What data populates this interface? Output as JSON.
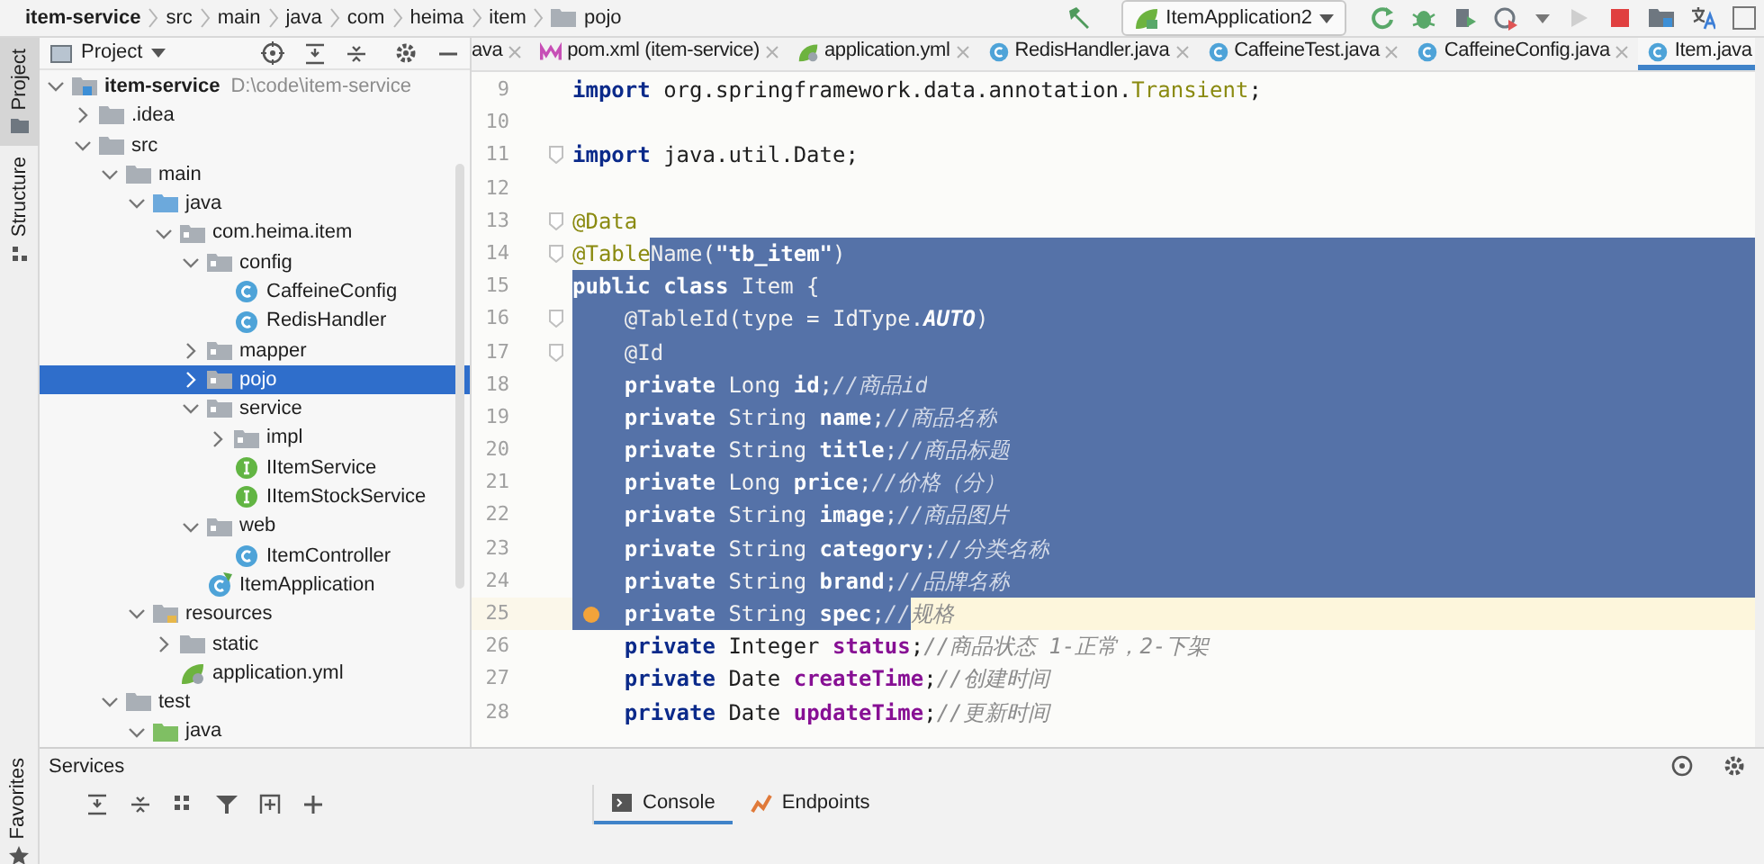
{
  "breadcrumbs": [
    {
      "label": "item-service",
      "kind": "module"
    },
    {
      "label": "src",
      "kind": "plain"
    },
    {
      "label": "main",
      "kind": "plain"
    },
    {
      "label": "java",
      "kind": "plain"
    },
    {
      "label": "com",
      "kind": "plain"
    },
    {
      "label": "heima",
      "kind": "plain"
    },
    {
      "label": "item",
      "kind": "plain"
    },
    {
      "label": "pojo",
      "kind": "package"
    }
  ],
  "run_config": {
    "label": "ItemApplication2"
  },
  "side_tabs": [
    {
      "label": "Project",
      "selected": true
    },
    {
      "label": "Structure",
      "selected": false
    }
  ],
  "side_tabs_bottom": [
    {
      "label": "Favorites",
      "selected": false
    }
  ],
  "project_panel": {
    "title": "Project",
    "tree": [
      {
        "name": "item-service",
        "kind": "module",
        "detail": "D:\\code\\item-service",
        "expanded": true,
        "selected": false,
        "children": [
          {
            "name": ".idea",
            "kind": "folder",
            "expanded": false,
            "selected": false
          },
          {
            "name": "src",
            "kind": "folder",
            "expanded": true,
            "selected": false,
            "children": [
              {
                "name": "main",
                "kind": "folder",
                "expanded": true,
                "selected": false,
                "children": [
                  {
                    "name": "java",
                    "kind": "source",
                    "expanded": true,
                    "selected": false,
                    "children": [
                      {
                        "name": "com.heima.item",
                        "kind": "package",
                        "expanded": true,
                        "selected": false,
                        "children": [
                          {
                            "name": "config",
                            "kind": "package",
                            "expanded": true,
                            "selected": false,
                            "children": [
                              {
                                "name": "CaffeineConfig",
                                "kind": "class",
                                "selected": false
                              },
                              {
                                "name": "RedisHandler",
                                "kind": "class",
                                "selected": false
                              }
                            ]
                          },
                          {
                            "name": "mapper",
                            "kind": "package",
                            "expanded": false,
                            "selected": false
                          },
                          {
                            "name": "pojo",
                            "kind": "package",
                            "expanded": false,
                            "selected": true
                          },
                          {
                            "name": "service",
                            "kind": "package",
                            "expanded": true,
                            "selected": false,
                            "children": [
                              {
                                "name": "impl",
                                "kind": "package",
                                "expanded": false,
                                "selected": false
                              },
                              {
                                "name": "IItemService",
                                "kind": "interface",
                                "selected": false
                              },
                              {
                                "name": "IItemStockService",
                                "kind": "interface",
                                "selected": false
                              }
                            ]
                          },
                          {
                            "name": "web",
                            "kind": "package",
                            "expanded": true,
                            "selected": false,
                            "children": [
                              {
                                "name": "ItemController",
                                "kind": "class",
                                "selected": false
                              }
                            ]
                          },
                          {
                            "name": "ItemApplication",
                            "kind": "spring",
                            "selected": false
                          }
                        ]
                      }
                    ]
                  },
                  {
                    "name": "resources",
                    "kind": "resources",
                    "expanded": true,
                    "selected": false,
                    "children": [
                      {
                        "name": "static",
                        "kind": "folder",
                        "expanded": false,
                        "selected": false
                      },
                      {
                        "name": "application.yml",
                        "kind": "yml",
                        "selected": false
                      }
                    ]
                  }
                ]
              },
              {
                "name": "test",
                "kind": "folder",
                "expanded": true,
                "selected": false,
                "children": [
                  {
                    "name": "java",
                    "kind": "test",
                    "expanded": true,
                    "selected": false
                  }
                ]
              }
            ]
          }
        ]
      }
    ]
  },
  "editor": {
    "tabs": [
      {
        "label": "ava",
        "kind": "cut",
        "selected": false
      },
      {
        "label": "pom.xml (item-service)",
        "kind": "maven",
        "selected": false
      },
      {
        "label": "application.yml",
        "kind": "yml",
        "selected": false
      },
      {
        "label": "RedisHandler.java",
        "kind": "class",
        "selected": false
      },
      {
        "label": "CaffeineTest.java",
        "kind": "test",
        "selected": false
      },
      {
        "label": "CaffeineConfig.java",
        "kind": "class",
        "selected": false
      },
      {
        "label": "Item.java",
        "kind": "class",
        "selected": true
      }
    ],
    "lines": [
      {
        "number": "9",
        "fold": false,
        "current": false,
        "marker": false,
        "segments": [
          {
            "selected": false,
            "tokens": [
              {
                "text": "import",
                "kind": "keyword"
              },
              {
                "text": " org.springframework.data.annotation.",
                "kind": "plain"
              },
              {
                "text": "Transient",
                "kind": "annotation"
              },
              {
                "text": ";",
                "kind": "plain"
              }
            ]
          }
        ]
      },
      {
        "number": "10",
        "fold": false,
        "current": false,
        "marker": false
      },
      {
        "number": "11",
        "fold": true,
        "current": false,
        "marker": false,
        "segments": [
          {
            "selected": false,
            "tokens": [
              {
                "text": "import",
                "kind": "keyword"
              },
              {
                "text": " java.util.Date;",
                "kind": "plain"
              }
            ]
          }
        ]
      },
      {
        "number": "12",
        "fold": false,
        "current": false,
        "marker": false
      },
      {
        "number": "13",
        "fold": true,
        "current": false,
        "marker": false,
        "segments": [
          {
            "selected": false,
            "tokens": [
              {
                "text": "@Data",
                "kind": "annotation"
              }
            ]
          }
        ]
      },
      {
        "number": "14",
        "fold": true,
        "current": false,
        "marker": false,
        "segments": [
          {
            "selected": false,
            "tokens": [
              {
                "text": "@Table",
                "kind": "annotation"
              }
            ]
          },
          {
            "selected": true,
            "tokens": [
              {
                "text": "Name",
                "kind": "annotation"
              },
              {
                "text": "(",
                "kind": "plain"
              },
              {
                "text": "\"tb_item\"",
                "kind": "string"
              },
              {
                "text": ")",
                "kind": "plain"
              }
            ]
          }
        ]
      },
      {
        "number": "15",
        "fold": false,
        "current": false,
        "marker": false,
        "segments": [
          {
            "selected": true,
            "tokens": [
              {
                "text": "public class",
                "kind": "keyword"
              },
              {
                "text": " Item {",
                "kind": "plain"
              }
            ]
          }
        ]
      },
      {
        "number": "16",
        "fold": true,
        "current": false,
        "marker": false,
        "segments": [
          {
            "selected": true,
            "tokens": [
              {
                "text": "    @TableId",
                "kind": "annotation"
              },
              {
                "text": "(type = IdType.",
                "kind": "plain"
              },
              {
                "text": "AUTO",
                "kind": "constant"
              },
              {
                "text": ")",
                "kind": "plain"
              }
            ]
          }
        ]
      },
      {
        "number": "17",
        "fold": true,
        "current": false,
        "marker": false,
        "segments": [
          {
            "selected": true,
            "tokens": [
              {
                "text": "    @Id",
                "kind": "annotation"
              }
            ]
          }
        ]
      },
      {
        "number": "18",
        "fold": false,
        "current": false,
        "marker": false,
        "segments": [
          {
            "selected": true,
            "tokens": [
              {
                "text": "    private",
                "kind": "keyword"
              },
              {
                "text": " Long ",
                "kind": "plain"
              },
              {
                "text": "id",
                "kind": "field"
              },
              {
                "text": ";",
                "kind": "plain"
              },
              {
                "text": "//商品id",
                "kind": "comment"
              }
            ]
          }
        ]
      },
      {
        "number": "19",
        "fold": false,
        "current": false,
        "marker": false,
        "segments": [
          {
            "selected": true,
            "tokens": [
              {
                "text": "    private",
                "kind": "keyword"
              },
              {
                "text": " String ",
                "kind": "plain"
              },
              {
                "text": "name",
                "kind": "field"
              },
              {
                "text": ";",
                "kind": "plain"
              },
              {
                "text": "//商品名称",
                "kind": "comment"
              }
            ]
          }
        ]
      },
      {
        "number": "20",
        "fold": false,
        "current": false,
        "marker": false,
        "segments": [
          {
            "selected": true,
            "tokens": [
              {
                "text": "    private",
                "kind": "keyword"
              },
              {
                "text": " String ",
                "kind": "plain"
              },
              {
                "text": "title",
                "kind": "field"
              },
              {
                "text": ";",
                "kind": "plain"
              },
              {
                "text": "//商品标题",
                "kind": "comment"
              }
            ]
          }
        ]
      },
      {
        "number": "21",
        "fold": false,
        "current": false,
        "marker": false,
        "segments": [
          {
            "selected": true,
            "tokens": [
              {
                "text": "    private",
                "kind": "keyword"
              },
              {
                "text": " Long ",
                "kind": "plain"
              },
              {
                "text": "price",
                "kind": "field"
              },
              {
                "text": ";",
                "kind": "plain"
              },
              {
                "text": "//价格（分）",
                "kind": "comment"
              }
            ]
          }
        ]
      },
      {
        "number": "22",
        "fold": false,
        "current": false,
        "marker": false,
        "segments": [
          {
            "selected": true,
            "tokens": [
              {
                "text": "    private",
                "kind": "keyword"
              },
              {
                "text": " String ",
                "kind": "plain"
              },
              {
                "text": "image",
                "kind": "field"
              },
              {
                "text": ";",
                "kind": "plain"
              },
              {
                "text": "//商品图片",
                "kind": "comment"
              }
            ]
          }
        ]
      },
      {
        "number": "23",
        "fold": false,
        "current": false,
        "marker": false,
        "segments": [
          {
            "selected": true,
            "tokens": [
              {
                "text": "    private",
                "kind": "keyword"
              },
              {
                "text": " String ",
                "kind": "plain"
              },
              {
                "text": "category",
                "kind": "field"
              },
              {
                "text": ";",
                "kind": "plain"
              },
              {
                "text": "//分类名称",
                "kind": "comment"
              }
            ]
          }
        ]
      },
      {
        "number": "24",
        "fold": false,
        "current": false,
        "marker": false,
        "segments": [
          {
            "selected": true,
            "tokens": [
              {
                "text": "    private",
                "kind": "keyword"
              },
              {
                "text": " String ",
                "kind": "plain"
              },
              {
                "text": "brand",
                "kind": "field"
              },
              {
                "text": ";",
                "kind": "plain"
              },
              {
                "text": "//品牌名称",
                "kind": "comment"
              }
            ]
          }
        ]
      },
      {
        "number": "25",
        "fold": false,
        "current": true,
        "marker": true,
        "segments": [
          {
            "selected": true,
            "tokens": [
              {
                "text": "    private",
                "kind": "keyword"
              },
              {
                "text": " String ",
                "kind": "plain"
              },
              {
                "text": "spec",
                "kind": "field"
              },
              {
                "text": ";",
                "kind": "plain"
              },
              {
                "text": "//",
                "kind": "comment"
              }
            ]
          },
          {
            "selected": false,
            "tokens": [
              {
                "text": "规格",
                "kind": "comment"
              }
            ]
          }
        ]
      },
      {
        "number": "26",
        "fold": false,
        "current": false,
        "marker": false,
        "segments": [
          {
            "selected": false,
            "tokens": [
              {
                "text": "    private",
                "kind": "keyword"
              },
              {
                "text": " Integer ",
                "kind": "plain"
              },
              {
                "text": "status",
                "kind": "field"
              },
              {
                "text": ";",
                "kind": "plain"
              },
              {
                "text": "//商品状态 1-正常，2-下架",
                "kind": "comment"
              }
            ]
          }
        ]
      },
      {
        "number": "27",
        "fold": false,
        "current": false,
        "marker": false,
        "segments": [
          {
            "selected": false,
            "tokens": [
              {
                "text": "    private",
                "kind": "keyword"
              },
              {
                "text": " Date ",
                "kind": "plain"
              },
              {
                "text": "createTime",
                "kind": "field"
              },
              {
                "text": ";",
                "kind": "plain"
              },
              {
                "text": "//创建时间",
                "kind": "comment"
              }
            ]
          }
        ]
      },
      {
        "number": "28",
        "fold": false,
        "current": false,
        "marker": false,
        "segments": [
          {
            "selected": false,
            "tokens": [
              {
                "text": "    private",
                "kind": "keyword"
              },
              {
                "text": " Date ",
                "kind": "plain"
              },
              {
                "text": "updateTime",
                "kind": "field"
              },
              {
                "text": ";",
                "kind": "plain"
              },
              {
                "text": "//更新时间",
                "kind": "comment"
              }
            ]
          }
        ]
      }
    ]
  },
  "services": {
    "title": "Services",
    "tabs": [
      {
        "label": "Console",
        "kind": "console",
        "selected": true
      },
      {
        "label": "Endpoints",
        "kind": "endpoints",
        "selected": false
      }
    ]
  }
}
